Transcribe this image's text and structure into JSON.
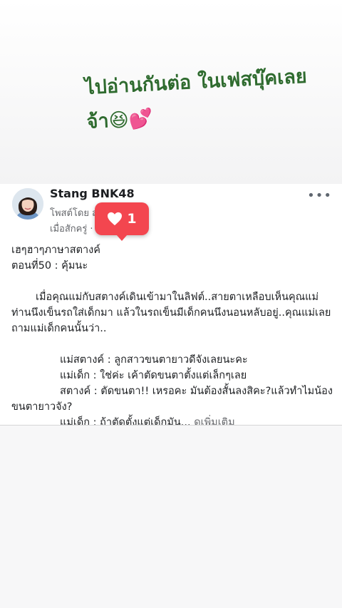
{
  "story": {
    "line1": "ไปอ่านกันต่อ ในเฟสบุ๊คเลย",
    "line2": "จ้า😆💕"
  },
  "post": {
    "author": "Stang BNK48",
    "posted_by": "โพสต์โดย ส",
    "time": "เมื่อสักครู่ ·",
    "more_icon": "•••",
    "lines": [
      "เฮๆฮาๆภาษาสตางค์",
      "ตอนที่50 : คุ้มนะ",
      "เมื่อคุณแม่กับสตางค์เดินเข้ามาในลิฟต์..สายตาเหลือบเห็นคุณแม่ท่านนึงเข็นรถใส่เด็กมา แล้วในรถเข็นมีเด็กคนนึงนอนหลับอยู่..คุณแม่เลยถามแม่เด็กคนนั้นว่า..",
      "แม่สตางค์ : ลูกสาวขนตายาวดีจังเลยนะคะ",
      "แม่เด็ก : ใช่ค่ะ เค้าตัดขนตาตั้งแต่เล็กๆเลย",
      "สตางค์ : ตัดขนตา!! เหรอคะ มันต้องสั้นลงสิคะ?แล้วทำไมน้องขนตายาวจัง?",
      "แม่เด็ก : ถ้าตัดตั้งแต่เด็กมัน..."
    ],
    "see_more": "ดูเพิ่มเติม"
  },
  "like_sticker": {
    "icon": "heart-icon",
    "count": "1",
    "color": "#f3464f"
  }
}
